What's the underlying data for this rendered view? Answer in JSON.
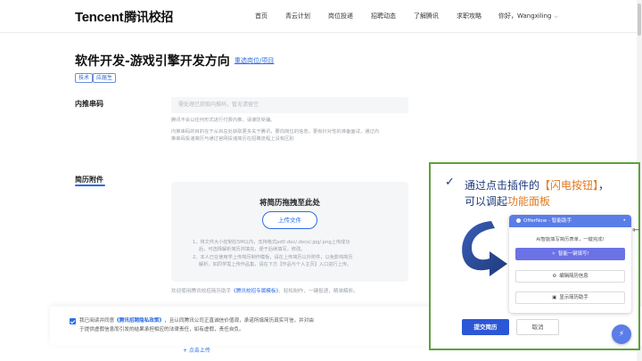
{
  "header": {
    "logo_latin": "Tencent",
    "logo_cn": "腾讯校招",
    "nav": [
      "首页",
      "青云计划",
      "岗位投递",
      "招聘动态",
      "了解腾讯",
      "求职攻略"
    ],
    "user": "你好，Wangxiling"
  },
  "job": {
    "title": "软件开发-游戏引擎开发方向",
    "reselect": "重选岗位/项目",
    "tags": [
      "技术",
      "应届生"
    ]
  },
  "referral": {
    "label": "内推串码",
    "placeholder": "需处理已获取内推码，暂无请留空",
    "help_1": "腾讯不会以任何形式进行付费内推，请谨防受骗。",
    "help_2": "内推串码的目的在于从目总处获取更多关于腾讯，要向岗位的信息，更有针对性的准备面试，通过内",
    "help_3": "推串码投递简历与通过官网投递简历在招聘流程上没有区别"
  },
  "resume": {
    "label": "简历附件",
    "drop_title": "将简历拖拽至此处",
    "upload_button": "上传文件",
    "note_1": "1、将文件大小控制在5M以内，支持格式pdf/.doc/.docx/.jpg/.png上传成功",
    "note_2": "后，可选择解析简历并填充，便于后续填写，修改。",
    "note_3": "2、本人已在使用学上传简历制作模板，请在上传简历以外附件，以免影响简历",
    "note_4": "解析，如同学需上传作品集，请在下方【作品与个人主页】入口进行上传。",
    "assistant_tip_prefix": "欢迎使用腾讯校招简历助手",
    "assistant_tip_link": "《腾讯校招专属模板》",
    "assistant_tip_suffix": "，轻松制作，一键投递，精准解析。"
  },
  "agreement": {
    "line1_prefix": "我已阅读并同意",
    "line1_link": "《腾讯招聘隐私政策》",
    "line1_suffix": "，且认同腾讯公司正直诚信价值观，承诺所填简历真实可信，并对由",
    "line2": "于提供虚假信息而引发的结果承担相应的法律责任，如有虚假，责任自负。",
    "partial": "+ 点击上传"
  },
  "overlay": {
    "line1_text": "通过点击插件的",
    "line1_highlight": "【闪电按钮】",
    "line1_end": "，",
    "line2_text": "可以调起",
    "line2_highlight": "功能面板",
    "check": "✓",
    "colors": {
      "border": "#5ea13b",
      "text": "#1f3a7a",
      "highlight": "#e07a1f"
    }
  },
  "plugin": {
    "title": "OfferNow - 智能助手",
    "close": "•",
    "subtitle": "AI智能填写简历表单，一键完成!",
    "primary": "智能一键填写!",
    "edit": "编辑简历信息",
    "show": "显示简历助手"
  },
  "actions": {
    "submit": "提交简历",
    "cancel": "取消",
    "fab_icon": "⚡"
  },
  "colors": {
    "accent": "#2b6de6",
    "plugin": "#5a7de8"
  }
}
